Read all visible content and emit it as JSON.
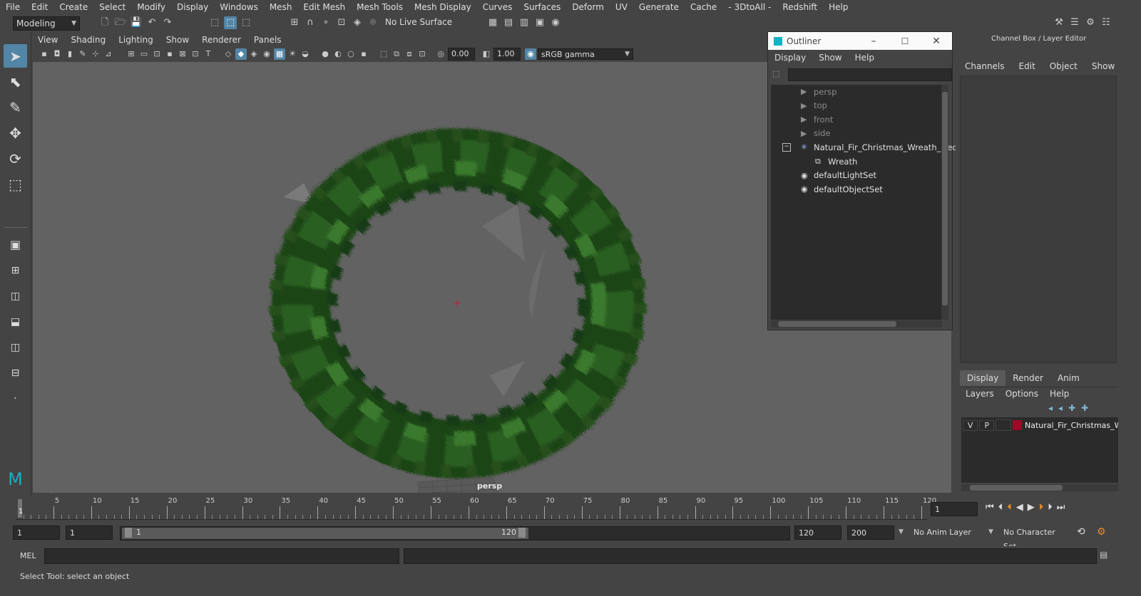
{
  "menu": [
    "File",
    "Edit",
    "Create",
    "Select",
    "Modify",
    "Display",
    "Windows",
    "Mesh",
    "Edit Mesh",
    "Mesh Tools",
    "Mesh Display",
    "Curves",
    "Surfaces",
    "Deform",
    "UV",
    "Generate",
    "Cache",
    "- 3DtoAll -",
    "Redshift",
    "Help"
  ],
  "shelf": {
    "mode": "Modeling",
    "live_surface": "No Live Surface"
  },
  "panel": {
    "menus": [
      "View",
      "Shading",
      "Lighting",
      "Show",
      "Renderer",
      "Panels"
    ],
    "exposure": "0.00",
    "gamma": "1.00",
    "color_space": "sRGB gamma"
  },
  "viewport": {
    "camera_label": "persp"
  },
  "outliner": {
    "title": "Outliner",
    "menus": [
      "Display",
      "Show",
      "Help"
    ],
    "items": [
      {
        "label": "persp",
        "type": "camera",
        "dim": true
      },
      {
        "label": "top",
        "type": "camera",
        "dim": true
      },
      {
        "label": "front",
        "type": "camera",
        "dim": true
      },
      {
        "label": "side",
        "type": "camera",
        "dim": true
      },
      {
        "label": "Natural_Fir_Christmas_Wreath_Deco",
        "type": "group",
        "dim": false
      },
      {
        "label": "Wreath",
        "type": "mesh",
        "dim": false
      },
      {
        "label": "defaultLightSet",
        "type": "set",
        "dim": false
      },
      {
        "label": "defaultObjectSet",
        "type": "set",
        "dim": false
      }
    ]
  },
  "channel_box": {
    "title": "Channel Box / Layer Editor",
    "menus": [
      "Channels",
      "Edit",
      "Object",
      "Show"
    ]
  },
  "layer_editor": {
    "tabs": [
      "Display",
      "Render",
      "Anim"
    ],
    "menus": [
      "Layers",
      "Options",
      "Help"
    ],
    "layer": {
      "v": "V",
      "p": "P",
      "name": "Natural_Fir_Christmas_W",
      "color": "#9b0b25"
    }
  },
  "timeline": {
    "ticks": [
      "5",
      "10",
      "15",
      "20",
      "25",
      "30",
      "35",
      "40",
      "45",
      "50",
      "55",
      "60",
      "65",
      "70",
      "75",
      "80",
      "85",
      "90",
      "95",
      "100",
      "105",
      "110",
      "115",
      "120"
    ],
    "start_marker": "1",
    "current_frame": "1"
  },
  "range": {
    "start": "1",
    "playback_start": "1",
    "slider_start": "1",
    "slider_end": "120",
    "playback_end": "120",
    "end": "200",
    "anim_layer": "No Anim Layer",
    "character_set": "No Character Set"
  },
  "command": {
    "language": "MEL"
  },
  "help_line": "Select Tool: select an object",
  "colors": {
    "accent": "#5285a6",
    "viewport_bg": "#626262",
    "layer_color": "#9b0b25"
  }
}
